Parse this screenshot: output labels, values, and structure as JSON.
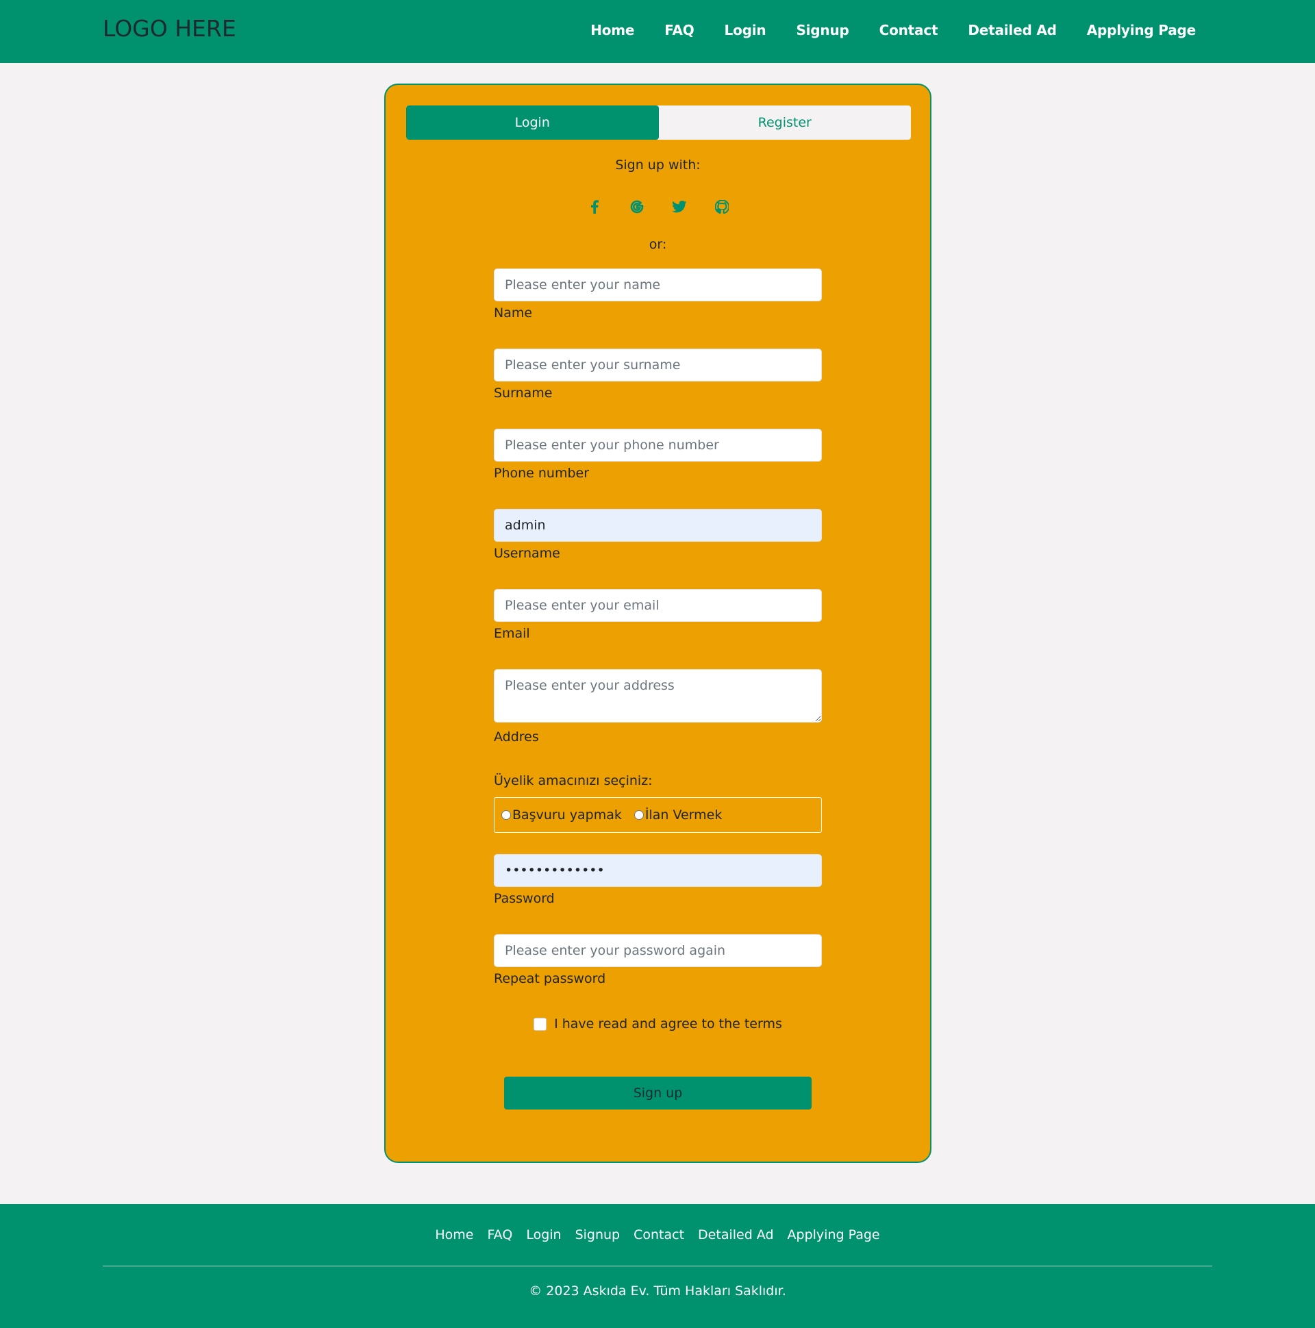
{
  "navbar": {
    "logo": "LOGO HERE",
    "links": [
      "Home",
      "FAQ",
      "Login",
      "Signup",
      "Contact",
      "Detailed Ad",
      "Applying Page"
    ]
  },
  "card": {
    "tabs": {
      "login": "Login",
      "register": "Register"
    },
    "signup_with": "Sign up with:",
    "socials": [
      "facebook-icon",
      "google-icon",
      "twitter-icon",
      "github-icon"
    ],
    "or": "or:",
    "fields": {
      "name": {
        "placeholder": "Please enter your name",
        "label": "Name"
      },
      "surname": {
        "placeholder": "Please enter your surname",
        "label": "Surname"
      },
      "phone": {
        "placeholder": "Please enter your phone number",
        "label": "Phone number"
      },
      "username": {
        "value": "admin",
        "label": "Username"
      },
      "email": {
        "placeholder": "Please enter your email",
        "label": "Email"
      },
      "address": {
        "placeholder": "Please enter your address",
        "label": "Addres"
      },
      "password": {
        "value": "•••••••••••••",
        "label": "Password"
      },
      "repeat": {
        "placeholder": "Please enter your password again",
        "label": "Repeat password"
      }
    },
    "purpose": {
      "label": "Üyelik amacınızı seçiniz:",
      "options": [
        "Başvuru yapmak",
        "İlan Vermek"
      ]
    },
    "terms": "I have read and agree to the terms",
    "submit": "Sign up"
  },
  "footer": {
    "links": [
      "Home",
      "FAQ",
      "Login",
      "Signup",
      "Contact",
      "Detailed Ad",
      "Applying Page"
    ],
    "copyright": "© 2023 Askıda Ev. Tüm Hakları Saklıdır."
  },
  "colors": {
    "primary": "#00916e",
    "card": "#eca002",
    "background": "#f4f2f3"
  }
}
